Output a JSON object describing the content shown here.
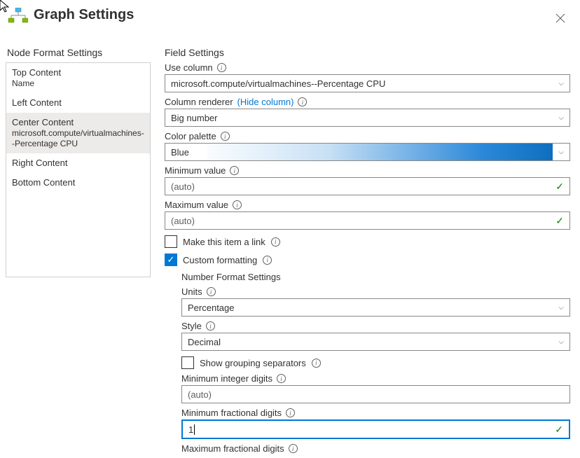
{
  "header": {
    "title": "Graph Settings"
  },
  "sidebar": {
    "title": "Node Format Settings",
    "items": [
      {
        "label": "Top Content",
        "sub": "Name",
        "selected": false
      },
      {
        "label": "Left Content",
        "sub": "",
        "selected": false
      },
      {
        "label": "Center Content",
        "sub": "microsoft.compute/virtualmachines--Percentage CPU",
        "selected": true
      },
      {
        "label": "Right Content",
        "sub": "",
        "selected": false
      },
      {
        "label": "Bottom Content",
        "sub": "",
        "selected": false
      }
    ]
  },
  "main": {
    "section_title": "Field Settings",
    "use_column": {
      "label": "Use column",
      "value": "microsoft.compute/virtualmachines--Percentage CPU"
    },
    "column_renderer": {
      "label": "Column renderer",
      "link": "(Hide column)",
      "value": "Big number"
    },
    "color_palette": {
      "label": "Color palette",
      "value": "Blue"
    },
    "min_value": {
      "label": "Minimum value",
      "placeholder": "(auto)"
    },
    "max_value": {
      "label": "Maximum value",
      "placeholder": "(auto)"
    },
    "make_link": {
      "label": "Make this item a link",
      "checked": false
    },
    "custom_formatting": {
      "label": "Custom formatting",
      "checked": true
    },
    "number_format": {
      "title": "Number Format Settings",
      "units": {
        "label": "Units",
        "value": "Percentage"
      },
      "style": {
        "label": "Style",
        "value": "Decimal"
      },
      "show_grouping": {
        "label": "Show grouping separators",
        "checked": false
      },
      "min_integer": {
        "label": "Minimum integer digits",
        "placeholder": "(auto)"
      },
      "min_fractional": {
        "label": "Minimum fractional digits",
        "value": "1"
      },
      "max_fractional": {
        "label": "Maximum fractional digits"
      }
    }
  }
}
